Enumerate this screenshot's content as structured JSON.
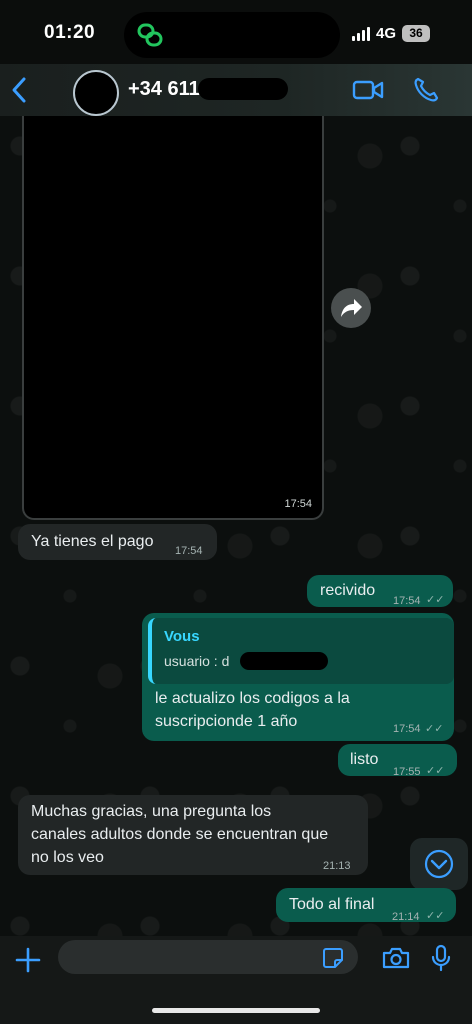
{
  "status_bar": {
    "time": "01:20",
    "network": "4G",
    "battery": "36"
  },
  "header": {
    "contact_name": "+34 611"
  },
  "messages": [
    {
      "media_time": "17:54"
    },
    {
      "text": "Ya tienes el pago",
      "time": "17:54"
    },
    {
      "text": "recivido",
      "time": "17:54",
      "ticks": "✓✓"
    },
    {
      "quote_author": "Vous",
      "quote_text": "usuario : d",
      "line1": "le actualizo los codigos a la",
      "line2": "suscripcionde 1 año",
      "time": "17:54",
      "ticks": "✓✓"
    },
    {
      "text": "listo",
      "time": "17:55",
      "ticks": "✓✓"
    },
    {
      "line1": "Muchas gracias, una pregunta los",
      "line2": "canales adultos donde se encuentran que",
      "line3": "no los veo",
      "time": "21:13"
    },
    {
      "text": "Todo al final",
      "time": "21:14",
      "ticks": "✓✓"
    }
  ],
  "input": {
    "placeholder": ""
  },
  "icons": {
    "back": "chevron-left-icon",
    "video": "video-camera-icon",
    "call": "phone-icon",
    "forward": "forward-arrow-icon",
    "scroll": "chevron-down-icon",
    "plus": "plus-icon",
    "sticker": "sticker-icon",
    "camera": "camera-icon",
    "mic": "microphone-icon"
  },
  "colors": {
    "accent": "#3b9eff",
    "outgoing_bubble": "#0a5c4d",
    "incoming_bubble": "#222626",
    "quote_bar": "#38d7ff",
    "island_icon": "#22c55e"
  }
}
